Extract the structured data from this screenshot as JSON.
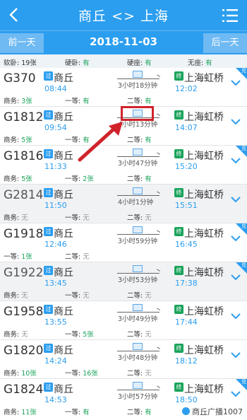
{
  "header": {
    "title": "商丘 <> 上海",
    "back_icon": "chevron-left-icon",
    "menu_icon": "list-icon"
  },
  "datebar": {
    "prev_label": "前一天",
    "date": "2018-11-03",
    "next_label": "后一天"
  },
  "summary": {
    "soft_sleeper_label": "软卧:",
    "soft_sleeper_value": "19张",
    "hard_sleeper_label": "硬卧:",
    "hard_sleeper_value": "有",
    "hard_seat_label": "硬座:",
    "hard_seat_value": "有",
    "no_seat_label": "无座:",
    "no_seat_value": "有"
  },
  "trains": [
    {
      "code": "G370",
      "dep_badge": "过",
      "dep_station": "商丘",
      "dep_time": "08:44",
      "duration": "3小时18分钟",
      "arr_badge": "终",
      "arr_station": "上海虹桥",
      "arr_time": "12:02",
      "business": "商务: 3张",
      "first": "一等: 有",
      "second": "二等: 有",
      "grey": false,
      "corner": "兑"
    },
    {
      "code": "G1812",
      "dep_badge": "过",
      "dep_station": "商丘",
      "dep_time": "09:54",
      "duration": "4小时13分钟",
      "arr_badge": "终",
      "arr_station": "上海虹桥",
      "arr_time": "14:07",
      "business": "商务: 5张",
      "first": "一等: 有",
      "second": "二等: 有",
      "grey": false,
      "corner": ""
    },
    {
      "code": "G1816",
      "dep_badge": "过",
      "dep_station": "商丘",
      "dep_time": "11:33",
      "duration": "3小时47分钟",
      "arr_badge": "终",
      "arr_station": "上海虹桥",
      "arr_time": "15:20",
      "business": "商务: 5张",
      "first": "一等: 2张",
      "second": "二等: 有",
      "grey": false,
      "corner": "兑"
    },
    {
      "code": "G2814",
      "dep_badge": "过",
      "dep_station": "商丘",
      "dep_time": "11:50",
      "duration": "4小时1分钟",
      "arr_badge": "终",
      "arr_station": "上海虹桥",
      "arr_time": "15:51",
      "business": "商务: 无",
      "first": "一等: 无",
      "second": "二等: 无",
      "grey": true,
      "corner": ""
    },
    {
      "code": "G1918",
      "dep_badge": "过",
      "dep_station": "商丘",
      "dep_time": "12:46",
      "duration": "3小时59分钟",
      "arr_badge": "终",
      "arr_station": "上海虹桥",
      "arr_time": "16:45",
      "business": "一等: 1张",
      "first": "二等: 无",
      "second": "",
      "grey": false,
      "corner": "兑"
    },
    {
      "code": "G1922",
      "dep_badge": "过",
      "dep_station": "商丘",
      "dep_time": "13:45",
      "duration": "3小时53分钟",
      "arr_badge": "终",
      "arr_station": "上海虹桥",
      "arr_time": "17:38",
      "business": "商务: 无",
      "first": "一等: 无",
      "second": "二等: 无",
      "grey": true,
      "corner": "兑"
    },
    {
      "code": "G1958",
      "dep_badge": "过",
      "dep_station": "商丘",
      "dep_time": "13:55",
      "duration": "3小时49分钟",
      "arr_badge": "终",
      "arr_station": "上海虹桥",
      "arr_time": "17:44",
      "business": "商务: 无",
      "first": "一等: 5张",
      "second": "二等: 无",
      "grey": false,
      "corner": ""
    },
    {
      "code": "G1820",
      "dep_badge": "过",
      "dep_station": "商丘",
      "dep_time": "14:24",
      "duration": "3小时48分钟",
      "arr_badge": "终",
      "arr_station": "上海虹桥",
      "arr_time": "18:12",
      "business": "商务: 10张",
      "first": "一等: 16张",
      "second": "二等: 无",
      "grey": false,
      "corner": ""
    },
    {
      "code": "G1824",
      "dep_badge": "过",
      "dep_station": "商丘",
      "dep_time": "14:53",
      "duration": "3小时57分钟",
      "arr_badge": "终",
      "arr_station": "上海虹桥",
      "arr_time": "18:50",
      "business": "商务: 11张",
      "first": "一等: 有",
      "second": "二等: 有",
      "grey": false,
      "corner": "兑"
    }
  ],
  "watermark": {
    "text": "商丘广播1007"
  },
  "colors": {
    "primary": "#2b9ef0",
    "available": "#1aa35a",
    "highlight": "#d0232b"
  }
}
